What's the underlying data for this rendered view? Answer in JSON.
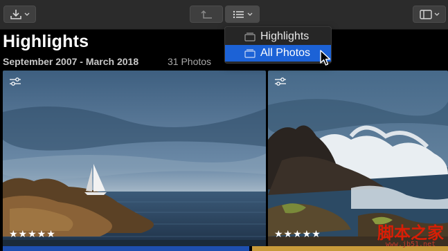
{
  "toolbar": {
    "import_icon": "download-tray-icon",
    "share_icon": "share-arrow-icon",
    "view_menu_icon": "list-view-icon",
    "sidebar_icon": "sidebar-toggle-icon"
  },
  "header": {
    "title": "Highlights",
    "date_range": "September 2007 - March 2018",
    "photo_count": "31 Photos"
  },
  "view_menu": {
    "items": [
      {
        "label": "Highlights",
        "icon": "stack-icon",
        "selected": false
      },
      {
        "label": "All Photos",
        "icon": "stack-icon",
        "selected": true
      }
    ]
  },
  "photos": [
    {
      "rating": "★★★★★",
      "subject": "sailboat and rocky coast",
      "adjust_icon": "sliders-icon"
    },
    {
      "rating": "★★★★★",
      "subject": "waves crashing on rocks",
      "adjust_icon": "sliders-icon"
    }
  ],
  "watermark": {
    "top": "脚本之家",
    "bottom": "www.jb51.net"
  },
  "colors": {
    "toolbar_bg": "#2b2b2b",
    "menu_selected": "#1c62d6",
    "background": "#000000"
  }
}
